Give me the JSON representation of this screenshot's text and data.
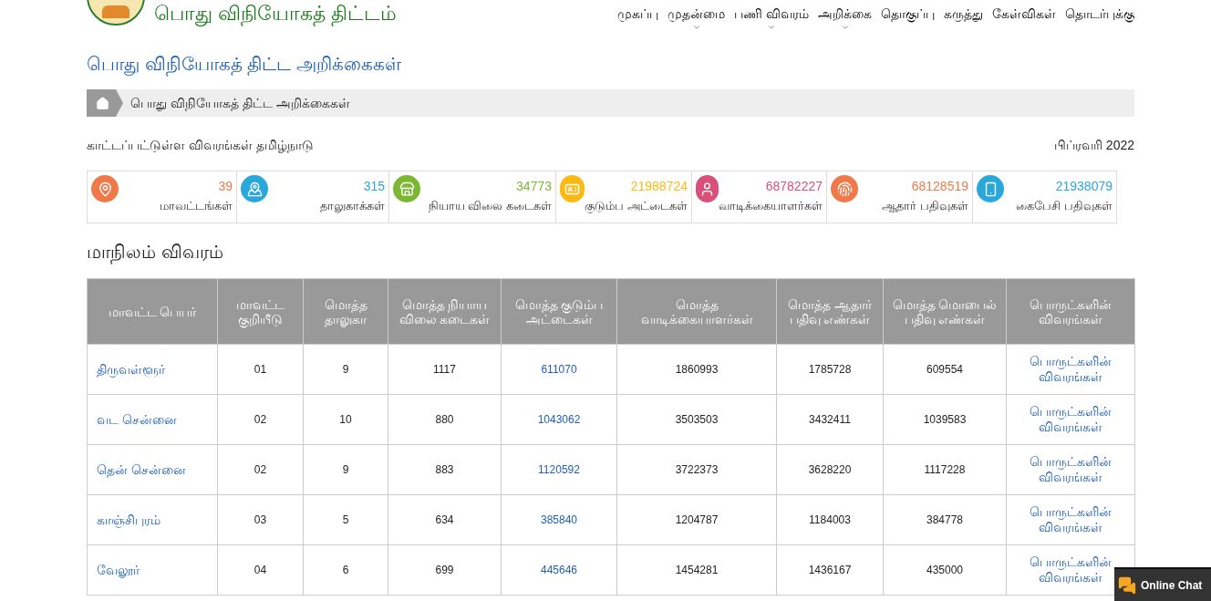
{
  "site": {
    "title": "பொது விநியோகத் திட்டம்"
  },
  "nav": [
    {
      "label": "முகப்பு",
      "dropdown": false
    },
    {
      "label": "முதன்மை",
      "dropdown": true
    },
    {
      "label": "பணி விவரம்",
      "dropdown": true
    },
    {
      "label": "அறிக்கை",
      "dropdown": true
    },
    {
      "label": "தொகுப்பு",
      "dropdown": false
    },
    {
      "label": "கருத்து",
      "dropdown": false
    },
    {
      "label": "கேள்விகள்",
      "dropdown": false
    },
    {
      "label": "தொடர்புக்கு",
      "dropdown": false
    }
  ],
  "page_title": "பொது விநியோகத் திட்ட அறிக்கைகள்",
  "breadcrumb": "பொது விநியோகத் திட்ட அறிக்கைகள்",
  "info": {
    "text": "காட்டப்பட்டுள்ள விவரங்கள் தமிழ்நாடு",
    "month": "பிப்ரவரி 2022"
  },
  "stats": [
    {
      "kind": "district",
      "value": "39",
      "label": "மாவட்டங்கள்",
      "color": "#f0794a"
    },
    {
      "kind": "taluk",
      "value": "315",
      "label": "தாலுகாக்கள்",
      "color": "#2aa7db"
    },
    {
      "kind": "shop",
      "value": "34773",
      "label": "நியாய விலை கடைகள்",
      "color": "#7cb733"
    },
    {
      "kind": "card",
      "value": "21988724",
      "label": "குடும்ப அட்டைகள்",
      "color": "#fcb912"
    },
    {
      "kind": "person",
      "value": "68782227",
      "label": "வாடிக்கையாளர்கள்",
      "color": "#d9507a"
    },
    {
      "kind": "aadhaar",
      "value": "68128519",
      "label": "ஆதார் பதிவுகள்",
      "color": "#f0794a"
    },
    {
      "kind": "mobile",
      "value": "21938079",
      "label": "கைபேசி பதிவுகள்",
      "color": "#2aa7db"
    }
  ],
  "section_title": "மாநிலம் விவரம்",
  "table": {
    "columns": [
      "மாவட்ட பெயர்",
      "மாவட்ட குறியீடு",
      "மொத்த தாலுகா",
      "மொத்த நியாய விலை கடைகள்",
      "மொத்த குடும்ப அட்டைகள்",
      "மொத்த வாடிக்கையாளர்கள்",
      "மொத்த ஆதார் பதிவு எண்கள்",
      "மொத்த மொபைல் பதிவு எண்கள்",
      "பொருட்களின் விவரங்கள்"
    ],
    "rows": [
      [
        "திருவள்ளூர்",
        "01",
        "9",
        "1117",
        "611070",
        "1860993",
        "1785728",
        "609554",
        "பொருட்களின் விவரங்கள்"
      ],
      [
        "வட சென்னை",
        "02",
        "10",
        "880",
        "1043062",
        "3503503",
        "3432411",
        "1039583",
        "பொருட்களின் விவரங்கள்"
      ],
      [
        "தென் சென்னை",
        "02",
        "9",
        "883",
        "1120592",
        "3722373",
        "3628220",
        "1117228",
        "பொருட்களின் விவரங்கள்"
      ],
      [
        "காஞ்சிபுரம்",
        "03",
        "5",
        "634",
        "385840",
        "1204787",
        "1184003",
        "384778",
        "பொருட்களின் விவரங்கள்"
      ],
      [
        "வேலூர்",
        "04",
        "6",
        "699",
        "445646",
        "1454281",
        "1436167",
        "435000",
        "பொருட்களின் விவரங்கள்"
      ]
    ]
  },
  "chat": {
    "label": "Online Chat"
  }
}
